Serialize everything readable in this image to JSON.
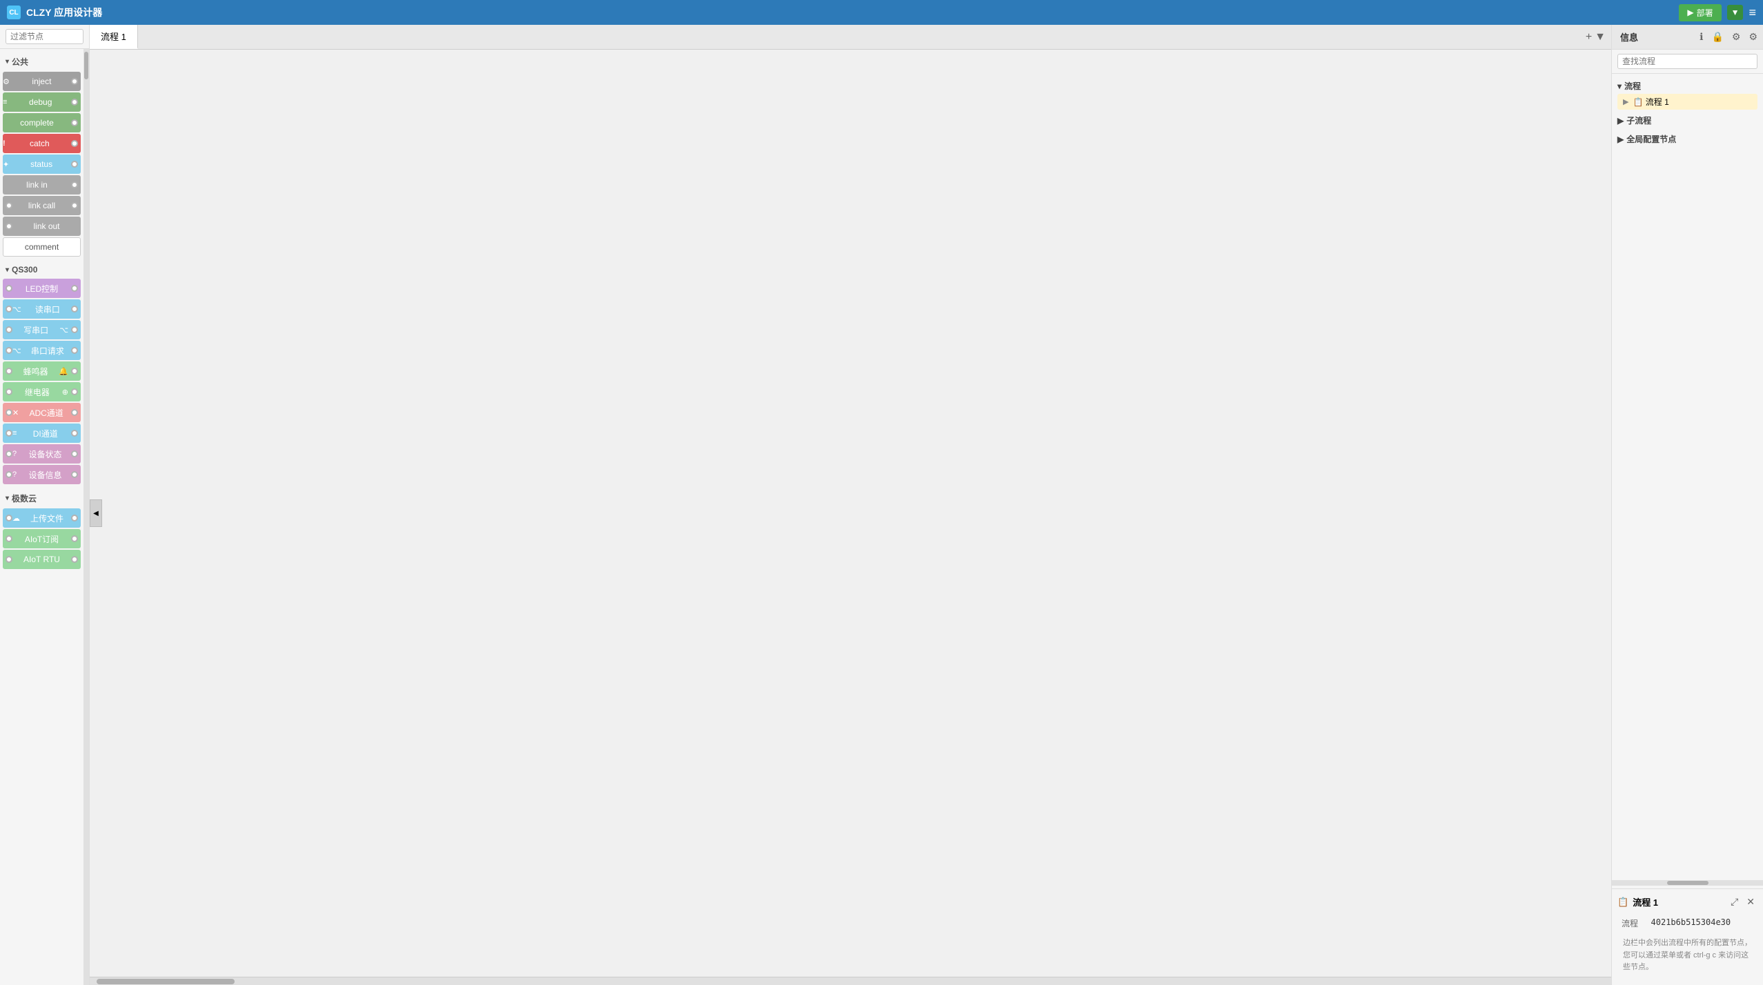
{
  "header": {
    "title": "CLZY 应用设计器",
    "logo": "CL",
    "deploy_label": "部署",
    "menu_icon": "≡"
  },
  "sidebar_left": {
    "search_placeholder": "过滤节点",
    "sections": [
      {
        "id": "public",
        "label": "公共",
        "expanded": true,
        "nodes": [
          {
            "id": "inject",
            "label": "inject",
            "color": "inject",
            "has_left_dot": false,
            "has_right_dot": true,
            "icon": "⚙"
          },
          {
            "id": "debug",
            "label": "debug",
            "color": "debug",
            "has_left_dot": false,
            "has_right_dot": true,
            "icon": "≡"
          },
          {
            "id": "complete",
            "label": "complete",
            "color": "complete",
            "has_left_dot": false,
            "has_right_dot": true,
            "icon": ""
          },
          {
            "id": "catch",
            "label": "catch",
            "color": "catch",
            "has_left_dot": false,
            "has_right_dot": true,
            "icon": "!"
          },
          {
            "id": "status",
            "label": "status",
            "color": "status",
            "has_left_dot": false,
            "has_right_dot": true,
            "icon": "✦"
          },
          {
            "id": "link-in",
            "label": "link in",
            "color": "link-in",
            "has_left_dot": false,
            "has_right_dot": true,
            "icon": ""
          },
          {
            "id": "link-call",
            "label": "link call",
            "color": "link-call",
            "has_left_dot": true,
            "has_right_dot": true,
            "icon": ""
          },
          {
            "id": "link-out",
            "label": "link out",
            "color": "link-out",
            "has_left_dot": true,
            "has_right_dot": false,
            "icon": ""
          },
          {
            "id": "comment",
            "label": "comment",
            "color": "comment",
            "has_left_dot": false,
            "has_right_dot": false,
            "icon": ""
          }
        ]
      },
      {
        "id": "qs300",
        "label": "QS300",
        "expanded": true,
        "nodes": [
          {
            "id": "led",
            "label": "LED控制",
            "color": "led",
            "has_left_dot": true,
            "has_right_dot": true,
            "icon": "💡"
          },
          {
            "id": "serial-read",
            "label": "读串口",
            "color": "serial-read",
            "has_left_dot": true,
            "has_right_dot": true,
            "icon": "⌥"
          },
          {
            "id": "serial-write",
            "label": "写串口",
            "color": "serial-write",
            "has_left_dot": true,
            "has_right_dot": true,
            "icon": "⌥"
          },
          {
            "id": "serial-req",
            "label": "串口请求",
            "color": "serial-req",
            "has_left_dot": true,
            "has_right_dot": true,
            "icon": "⌥"
          },
          {
            "id": "buzzer",
            "label": "蜂鸣器",
            "color": "buzzer",
            "has_left_dot": true,
            "has_right_dot": true,
            "icon": "🔔"
          },
          {
            "id": "relay",
            "label": "继电器",
            "color": "relay",
            "has_left_dot": true,
            "has_right_dot": true,
            "icon": "⊕"
          },
          {
            "id": "adc",
            "label": "ADC通道",
            "color": "adc",
            "has_left_dot": true,
            "has_right_dot": true,
            "icon": "✕"
          },
          {
            "id": "di",
            "label": "DI通道",
            "color": "di",
            "has_left_dot": true,
            "has_right_dot": true,
            "icon": "≡"
          },
          {
            "id": "device-status",
            "label": "设备状态",
            "color": "device-status",
            "has_left_dot": true,
            "has_right_dot": true,
            "icon": "?"
          },
          {
            "id": "device-info",
            "label": "设备信息",
            "color": "device-info",
            "has_left_dot": true,
            "has_right_dot": true,
            "icon": "?"
          }
        ]
      },
      {
        "id": "jiduyun",
        "label": "极数云",
        "expanded": true,
        "nodes": [
          {
            "id": "upload",
            "label": "上传文件",
            "color": "upload",
            "has_left_dot": true,
            "has_right_dot": true,
            "icon": "☁"
          },
          {
            "id": "aiot-sub",
            "label": "AIoT订阅",
            "color": "aiot-sub",
            "has_left_dot": true,
            "has_right_dot": true,
            "icon": ""
          },
          {
            "id": "aiot-rtu",
            "label": "AIoT RTU",
            "color": "aiot-rtu",
            "has_left_dot": true,
            "has_right_dot": true,
            "icon": ""
          }
        ]
      }
    ]
  },
  "canvas": {
    "tabs": [
      {
        "id": "flow1",
        "label": "流程 1",
        "active": true
      }
    ],
    "add_label": "+",
    "dropdown_label": "▼"
  },
  "sidebar_right": {
    "tabs": [
      {
        "id": "info",
        "label": "信息",
        "active": true
      }
    ],
    "search_placeholder": "查找流程",
    "icons": [
      "ℹ",
      "🔒",
      "⚙",
      "⚙"
    ],
    "tree": {
      "sections": [
        {
          "id": "flows",
          "label": "流程",
          "expanded": true,
          "items": [
            {
              "id": "flow1",
              "label": "流程 1",
              "active": true,
              "icon": "📋"
            }
          ]
        },
        {
          "id": "subflows",
          "label": "子流程",
          "expanded": false,
          "items": []
        },
        {
          "id": "global-config",
          "label": "全局配置节点",
          "expanded": false,
          "items": []
        }
      ]
    },
    "bottom_panel": {
      "title": "流程 1",
      "icon": "📋",
      "flow_label": "流程",
      "flow_id": "4021b6b515304e30",
      "hint": "边栏中会列出流程中所有的配置节点，您可以通过菜单或者 ctrl-g c 来访问这些节点。"
    }
  }
}
